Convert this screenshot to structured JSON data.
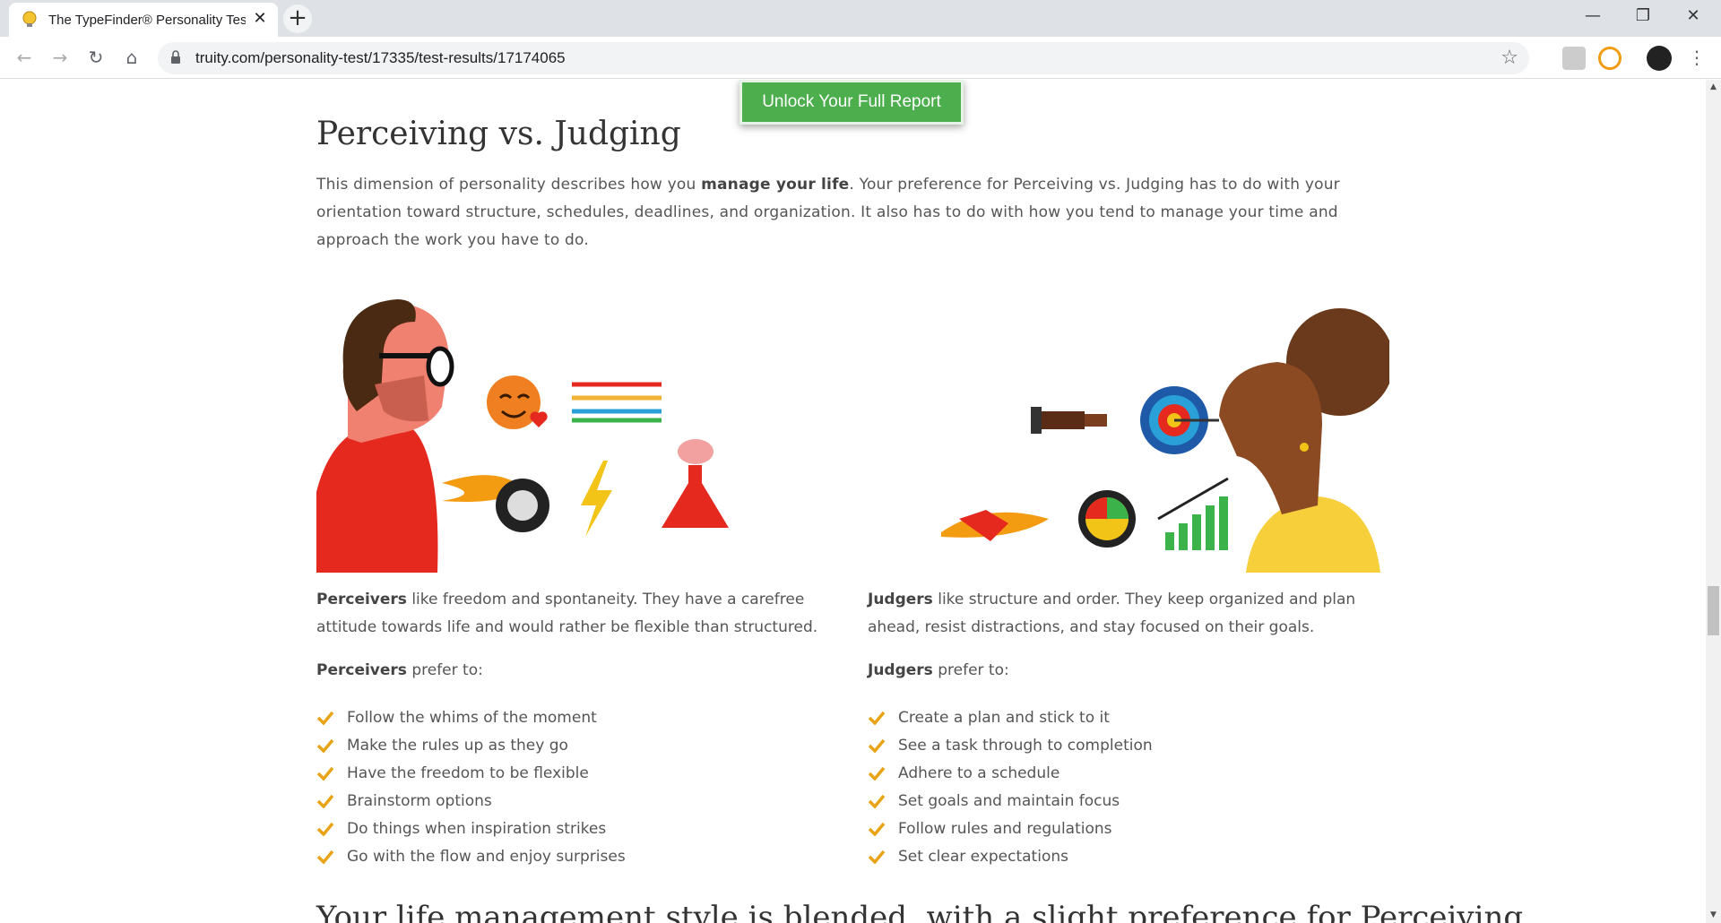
{
  "browser": {
    "tab_title": "The TypeFinder® Personality Test",
    "tab_close": "✕",
    "new_tab": "+",
    "url": "truity.com/personality-test/17335/test-results/17174065",
    "window_minimize": "—",
    "window_restore": "❐",
    "window_close": "✕",
    "back": "←",
    "forward": "→",
    "reload": "↻",
    "home": "⌂",
    "bookmark": "☆",
    "menu": "⋮"
  },
  "cta": {
    "label": "Unlock Your Full Report",
    "color": "#4cae4c"
  },
  "section": {
    "title": "Perceiving vs. Judging",
    "intro_pre": "This dimension of personality describes how you ",
    "intro_bold": "manage your life",
    "intro_post": ". Your preference for Perceiving vs. Judging has to do with your orientation toward structure, schedules, deadlines, and organization. It also has to do with how you tend to manage your time and approach the work you have to do."
  },
  "perceivers": {
    "name": "Perceivers",
    "desc": " like freedom and spontaneity. They have a carefree attitude towards life and would rather be flexible than structured.",
    "prefer_suffix": " prefer to:",
    "items": [
      "Follow the whims of the moment",
      "Make the rules up as they go",
      "Have the freedom to be flexible",
      "Brainstorm options",
      "Do things when inspiration strikes",
      "Go with the flow and enjoy surprises"
    ]
  },
  "judgers": {
    "name": "Judgers",
    "desc": " like structure and order. They keep organized and plan ahead, resist distractions, and stay focused on their goals.",
    "prefer_suffix": " prefer to:",
    "items": [
      "Create a plan and stick to it",
      "See a task through to completion",
      "Adhere to a schedule",
      "Set goals and maintain focus",
      "Follow rules and regulations",
      "Set clear expectations"
    ]
  },
  "next_heading": "Your life management style is blended, with a slight preference for Perceiving",
  "colors": {
    "check": "#e8a317",
    "heading": "#333333",
    "body": "#555555"
  }
}
